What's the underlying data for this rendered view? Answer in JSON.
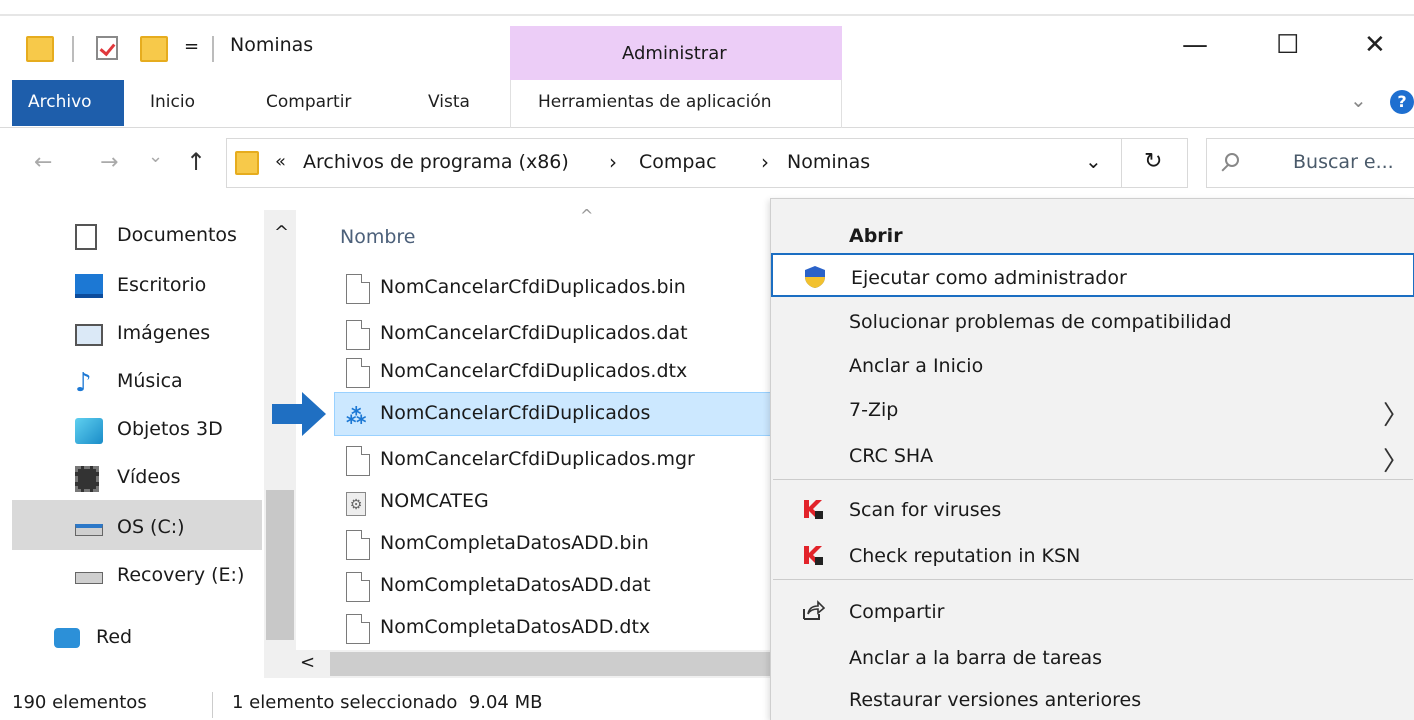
{
  "window": {
    "title": "Nominas",
    "contextual_tab_group": "Administrar",
    "qa_dropdown": "=",
    "minimize": "—",
    "maximize": "☐",
    "close": "✕"
  },
  "ribbon": {
    "tabs": [
      "Archivo",
      "Inicio",
      "Compartir",
      "Vista",
      "Herramientas de aplicación"
    ],
    "expand": "⌄",
    "help": "?"
  },
  "nav": {
    "back": "←",
    "forward": "→",
    "recent": "⌄",
    "up": "↑",
    "overflow": "«",
    "breadcrumb": [
      "Archivos de programa (x86)",
      "Compac",
      "Nominas"
    ],
    "crumb_sep": "›",
    "dropdown": "⌄",
    "refresh": "↻",
    "search_placeholder": "Buscar e..."
  },
  "navpane": {
    "items": [
      {
        "label": "Documentos",
        "icon": "documents-icon"
      },
      {
        "label": "Escritorio",
        "icon": "desktop-icon"
      },
      {
        "label": "Imágenes",
        "icon": "pictures-icon"
      },
      {
        "label": "Música",
        "icon": "music-icon"
      },
      {
        "label": "Objetos 3D",
        "icon": "objects3d-icon"
      },
      {
        "label": "Vídeos",
        "icon": "videos-icon"
      },
      {
        "label": "OS (C:)",
        "icon": "drive-icon"
      },
      {
        "label": "Recovery (E:)",
        "icon": "drive-icon"
      },
      {
        "label": "Red",
        "icon": "network-icon"
      }
    ],
    "scroll_up": "^",
    "scroll_down": "⌄"
  },
  "filelist": {
    "column": "Nombre",
    "sort_indicator": "^",
    "hscroll_left": "<",
    "files": [
      {
        "name": "NomCancelarCfdiDuplicados.bin",
        "icon": "file-icon"
      },
      {
        "name": "NomCancelarCfdiDuplicados.dat",
        "icon": "file-icon"
      },
      {
        "name": "NomCancelarCfdiDuplicados.dtx",
        "icon": "file-icon"
      },
      {
        "name": "NomCancelarCfdiDuplicados",
        "icon": "app-icon",
        "selected": true
      },
      {
        "name": "NomCancelarCfdiDuplicados.mgr",
        "icon": "file-icon"
      },
      {
        "name": "NOMCATEG",
        "icon": "settings-file-icon"
      },
      {
        "name": "NomCompletaDatosADD.bin",
        "icon": "file-icon"
      },
      {
        "name": "NomCompletaDatosADD.dat",
        "icon": "file-icon"
      },
      {
        "name": "NomCompletaDatosADD.dtx",
        "icon": "file-icon"
      }
    ]
  },
  "status": {
    "count": "190 elementos",
    "selection": "1 elemento seleccionado  9.04 MB"
  },
  "context_menu": {
    "items": [
      {
        "label": "Abrir",
        "bold": true
      },
      {
        "label": "Ejecutar como administrador",
        "icon": "shield-icon",
        "hover": true
      },
      {
        "label": "Solucionar problemas de compatibilidad"
      },
      {
        "label": "Anclar a Inicio"
      },
      {
        "label": "7-Zip",
        "submenu": true
      },
      {
        "label": "CRC SHA",
        "submenu": true
      },
      {
        "label": "Scan for viruses",
        "icon": "kaspersky-icon"
      },
      {
        "label": "Check reputation in KSN",
        "icon": "kaspersky-icon"
      },
      {
        "label": "Compartir",
        "icon": "share-icon"
      },
      {
        "label": "Anclar a la barra de tareas"
      },
      {
        "label": "Restaurar versiones anteriores"
      }
    ],
    "submenu_glyph": "〉"
  },
  "colors": {
    "file_tab": "#1e5eab",
    "contextual_tab": "#eccdf7",
    "selection": "#cce8ff",
    "menu_hover_border": "#1b6ec2",
    "arrow": "#1f6fc2"
  }
}
